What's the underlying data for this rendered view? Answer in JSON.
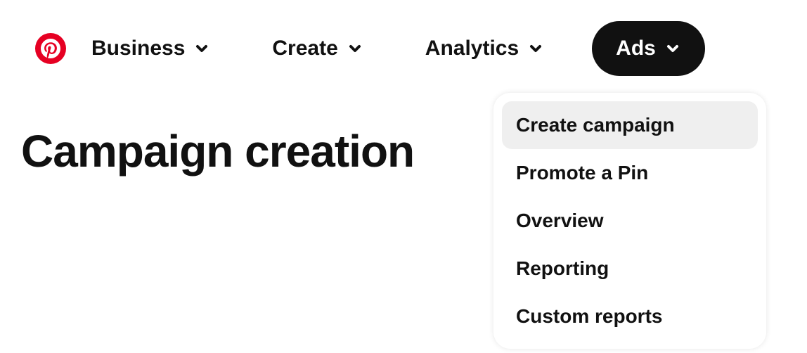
{
  "nav": {
    "business": "Business",
    "create": "Create",
    "analytics": "Analytics",
    "ads": "Ads"
  },
  "page": {
    "title": "Campaign creation"
  },
  "adsDropdown": {
    "items": [
      {
        "label": "Create campaign",
        "highlighted": true
      },
      {
        "label": "Promote a Pin",
        "highlighted": false
      },
      {
        "label": "Overview",
        "highlighted": false
      },
      {
        "label": "Reporting",
        "highlighted": false
      },
      {
        "label": "Custom reports",
        "highlighted": false
      }
    ]
  },
  "colors": {
    "brand": "#e60023",
    "text": "#111111"
  }
}
